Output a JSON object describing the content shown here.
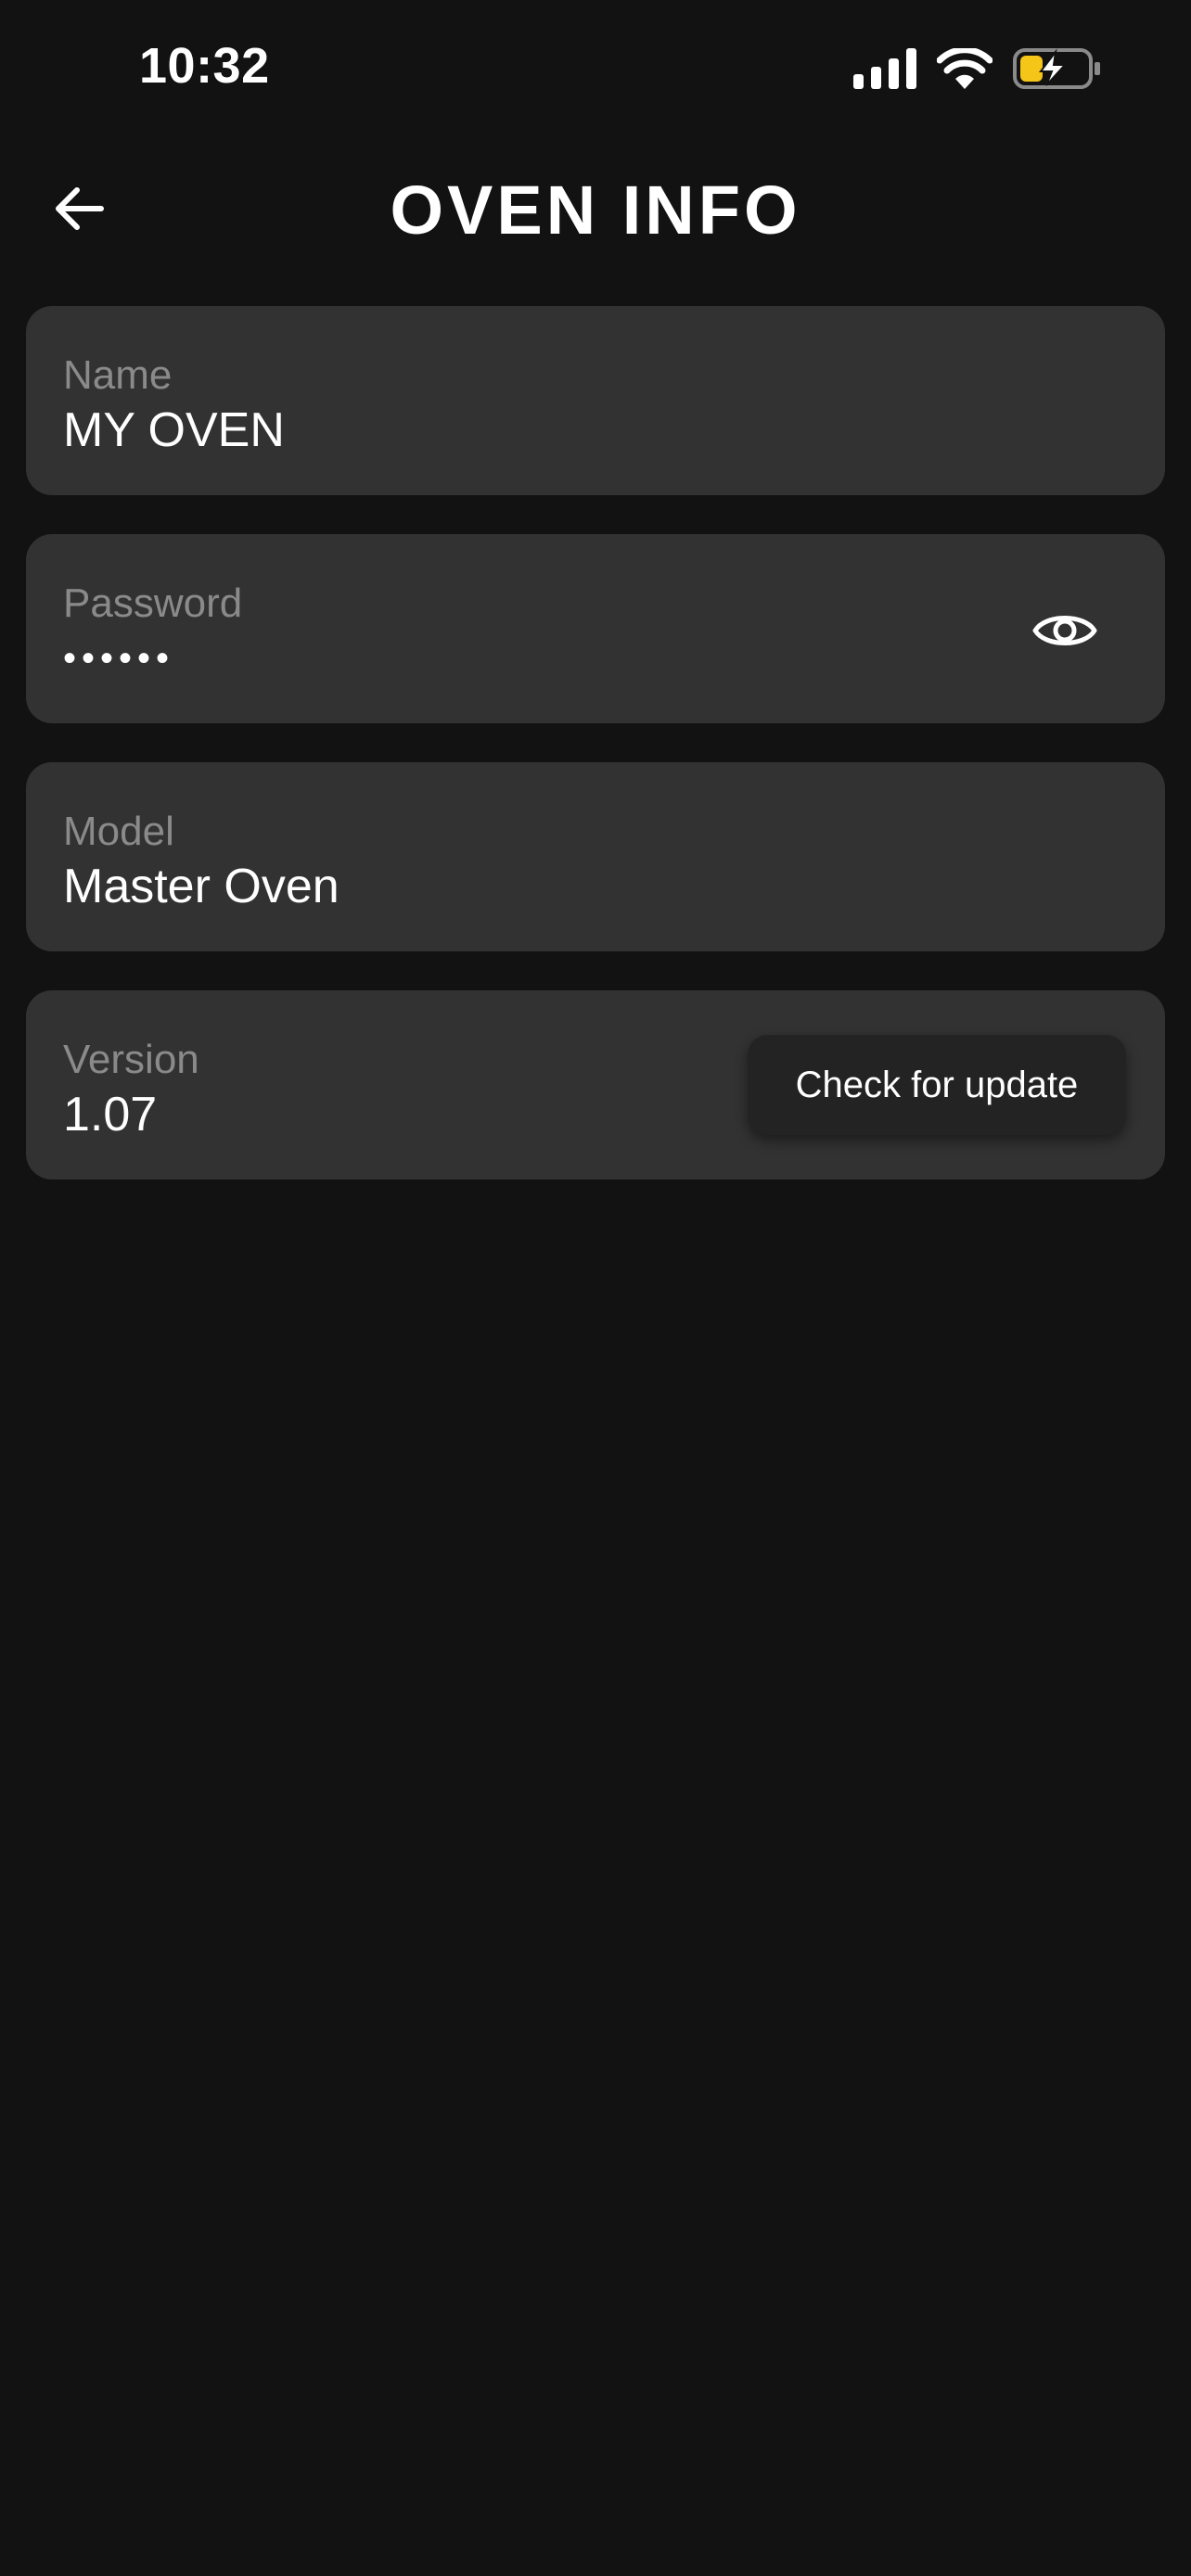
{
  "status_bar": {
    "time": "10:32",
    "icons": [
      "signal-icon",
      "wifi-icon",
      "battery-charging-icon"
    ],
    "battery_color": "#f5c518"
  },
  "header": {
    "title": "OVEN INFO",
    "back_icon": "arrow-left-icon"
  },
  "fields": {
    "name": {
      "label": "Name",
      "value": "MY OVEN"
    },
    "password": {
      "label": "Password",
      "value": "••••••",
      "toggle_icon": "eye-icon"
    },
    "model": {
      "label": "Model",
      "value": "Master Oven"
    },
    "version": {
      "label": "Version",
      "value": "1.07",
      "button_label": "Check for update"
    }
  },
  "colors": {
    "background": "#121212",
    "card": "#323232",
    "label": "#8a8a8a",
    "button": "#232323"
  }
}
